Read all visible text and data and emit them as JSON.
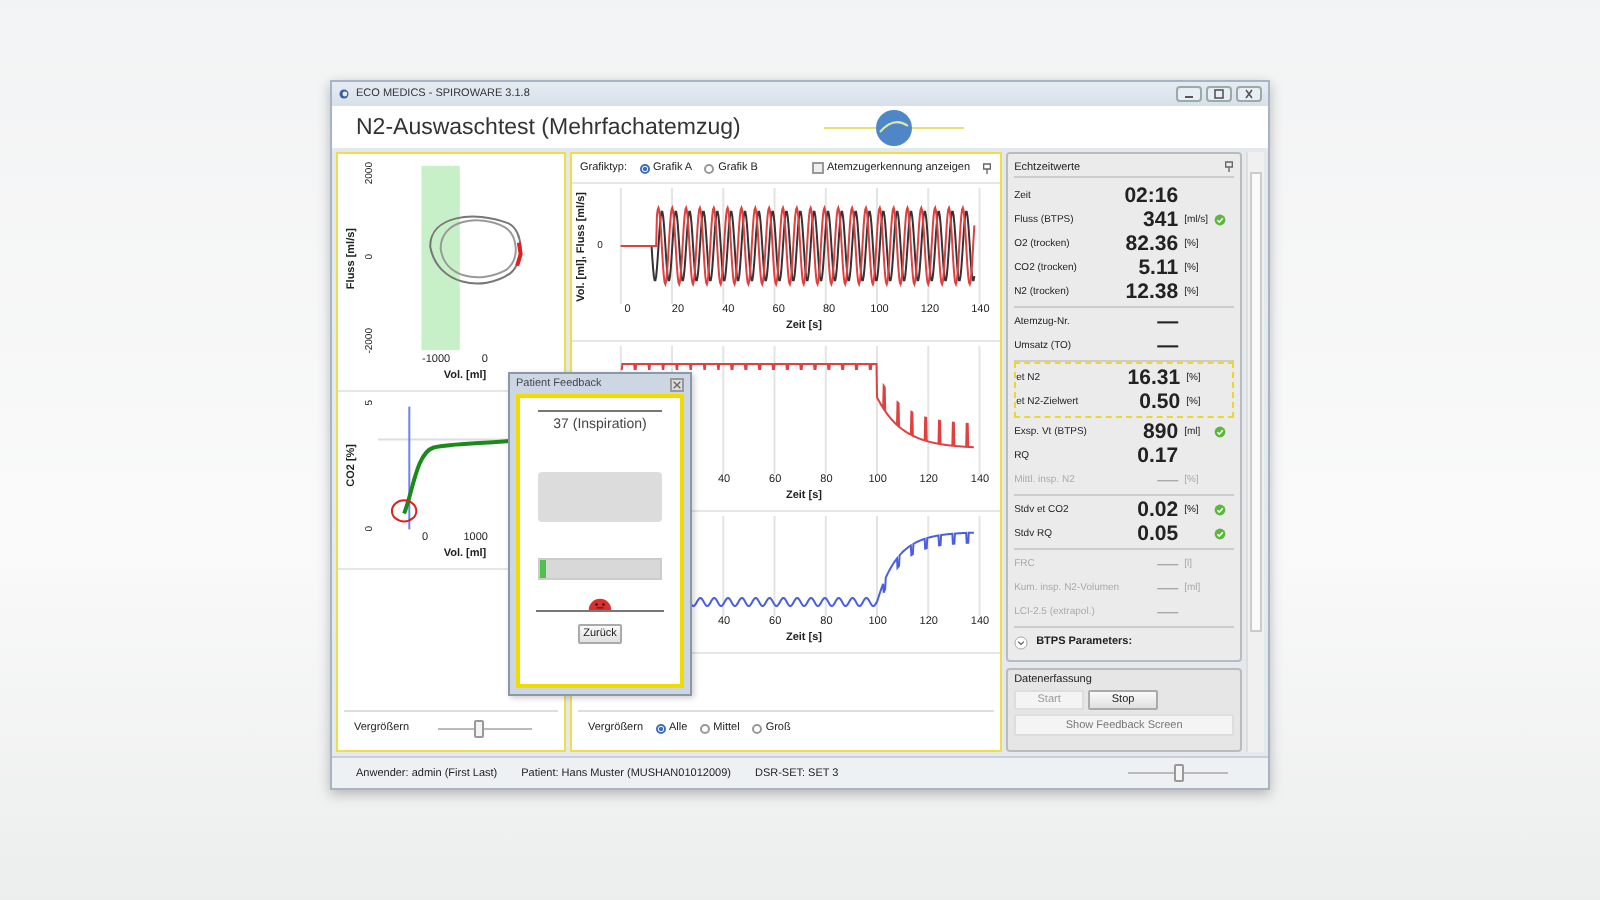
{
  "window": {
    "title": "ECO MEDICS - SPIROWARE 3.1.8"
  },
  "header": {
    "title": "N2-Auswaschtest (Mehrfachatemzug)"
  },
  "loop_charts": [
    {
      "kind": "flow",
      "ylabel": "Fluss [ml/s]",
      "yticks": [
        "2000",
        "0",
        "-2000"
      ],
      "xticks": [
        "-1000",
        "0"
      ],
      "xlabel": "Vol. [ml]"
    },
    {
      "kind": "co2",
      "ylabel": "CO2 [%]",
      "yticks": [
        "5",
        "0"
      ],
      "xticks": [
        "0",
        "1000"
      ],
      "xlabel": "Vol. [ml]"
    }
  ],
  "left_zoom": {
    "label": "Vergrößern",
    "level": 0.45
  },
  "graph_type": {
    "label": "Grafiktyp:",
    "options": [
      {
        "label": "Grafik A",
        "selected": true
      },
      {
        "label": "Grafik B",
        "selected": false
      }
    ]
  },
  "breath_detection": {
    "label": "Atemzugerkennung anzeigen",
    "checked": false
  },
  "time_charts": [
    {
      "kind": "flow",
      "ylabel": "Vol. [ml], Fluss [ml/s]",
      "yticks": [
        "0"
      ],
      "xticks": [
        "0",
        "20",
        "40",
        "60",
        "80",
        "100",
        "120",
        "140"
      ],
      "xlabel": "Zeit [s]"
    },
    {
      "kind": "n2",
      "xticks": [
        "40",
        "60",
        "80",
        "100",
        "120",
        "140"
      ],
      "xlabel": "Zeit [s]"
    },
    {
      "kind": "co2",
      "xticks": [
        "40",
        "60",
        "80",
        "100",
        "120",
        "140"
      ],
      "xlabel": "Zeit [s]"
    }
  ],
  "zoom_sizes": {
    "label": "Vergrößern",
    "options": [
      {
        "label": "Alle",
        "selected": true
      },
      {
        "label": "Mittel",
        "selected": false
      },
      {
        "label": "Groß",
        "selected": false
      }
    ]
  },
  "feedback_dialog": {
    "title": "Patient Feedback",
    "breath": "37 (Inspiration)",
    "level": 0.05,
    "button": "Zurück"
  },
  "realtime": {
    "title": "Echtzeitwerte",
    "groups": [
      {
        "highlighted": false,
        "rows": [
          {
            "label": "Zeit",
            "value": "02:16",
            "ok": false,
            "disabled": false
          },
          {
            "label": "Fluss (BTPS)",
            "value": "341",
            "unit": "[ml/s]",
            "ok": true,
            "disabled": false
          },
          {
            "label": "O2 (trocken)",
            "value": "82.36",
            "unit": "[%]",
            "ok": false,
            "disabled": false
          },
          {
            "label": "CO2 (trocken)",
            "value": "5.11",
            "unit": "[%]",
            "ok": false,
            "disabled": false
          },
          {
            "label": "N2 (trocken)",
            "value": "12.38",
            "unit": "[%]",
            "ok": false,
            "disabled": false
          }
        ]
      },
      {
        "highlighted": false,
        "rows": [
          {
            "label": "Atemzug-Nr.",
            "value": "—",
            "ok": false,
            "disabled": false
          },
          {
            "label": "Umsatz (TO)",
            "value": "—",
            "ok": false,
            "disabled": false
          }
        ]
      },
      {
        "highlighted": true,
        "rows": [
          {
            "label": "et N2",
            "value": "16.31",
            "unit": "[%]",
            "ok": false,
            "disabled": false
          },
          {
            "label": "et N2-Zielwert",
            "value": "0.50",
            "unit": "[%]",
            "ok": false,
            "disabled": false
          }
        ]
      },
      {
        "highlighted": false,
        "rows": [
          {
            "label": "Exsp. Vt (BTPS)",
            "value": "890",
            "unit": "[ml]",
            "ok": true,
            "disabled": false
          },
          {
            "label": "RQ",
            "value": "0.17",
            "ok": false,
            "disabled": false
          },
          {
            "label": "Mittl. insp. N2",
            "value": "—",
            "unit": "[%]",
            "ok": false,
            "disabled": true
          }
        ]
      },
      {
        "highlighted": false,
        "rows": [
          {
            "label": "Stdv et CO2",
            "value": "0.02",
            "unit": "[%]",
            "ok": true,
            "disabled": false
          },
          {
            "label": "Stdv RQ",
            "value": "0.05",
            "ok": true,
            "disabled": false
          }
        ]
      },
      {
        "highlighted": false,
        "rows": [
          {
            "label": "FRC",
            "value": "—",
            "unit": "[l]",
            "ok": false,
            "disabled": true
          },
          {
            "label": "Kum. insp. N2-Volumen",
            "value": "—",
            "unit": "[ml]",
            "ok": false,
            "disabled": true
          },
          {
            "label": "LCI-2.5 (extrapol.)",
            "value": "—",
            "ok": false,
            "disabled": true
          }
        ]
      }
    ],
    "btps": {
      "label": "BTPS Parameters:",
      "expanded": false
    }
  },
  "acquisition": {
    "title": "Datenerfassung",
    "buttons": [
      {
        "label": "Start",
        "disabled": true
      },
      {
        "label": "Stop",
        "disabled": false
      }
    ],
    "feedback_button": "Show Feedback Screen"
  },
  "status_bar": {
    "user": "Anwender: admin (First Last)",
    "patient": "Patient: Hans Muster (MUSHAN01012009)",
    "dsr_set": "DSR-SET: SET 3",
    "level": 0.5
  }
}
